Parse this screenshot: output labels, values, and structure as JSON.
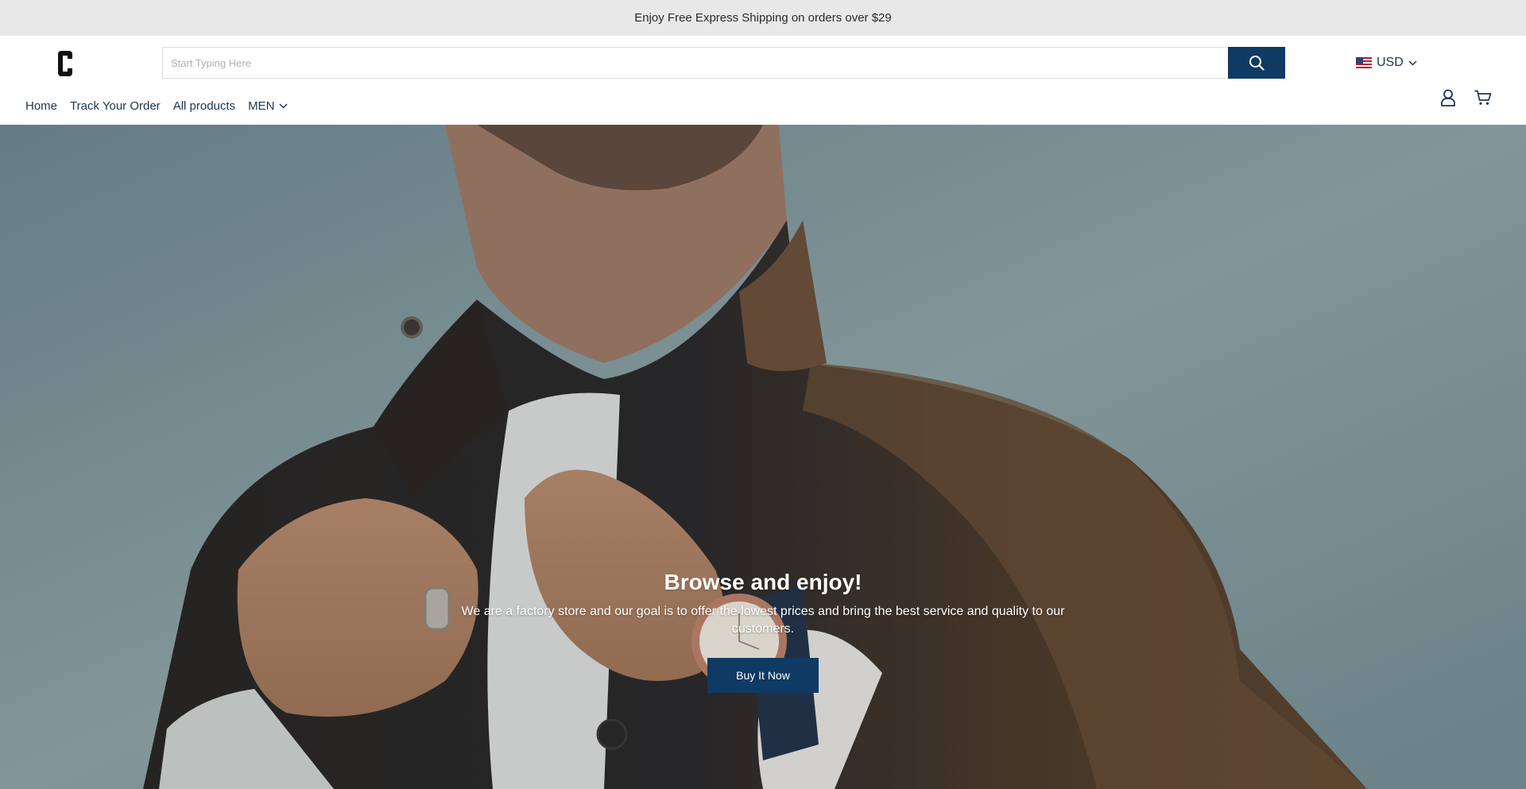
{
  "announcement": {
    "text": "Enjoy Free Express Shipping on orders over $29"
  },
  "header": {
    "logo_letter": "C",
    "search": {
      "placeholder": "Start Typing Here",
      "value": ""
    },
    "currency": {
      "code": "USD",
      "flag": "us-flag-icon"
    },
    "icons": {
      "search": "search-icon",
      "account": "user-icon",
      "cart": "cart-icon",
      "chevron": "chevron-down-icon"
    }
  },
  "nav": {
    "items": [
      {
        "label": "Home"
      },
      {
        "label": "Track Your Order"
      },
      {
        "label": "All products"
      },
      {
        "label": "MEN",
        "has_dropdown": true
      }
    ]
  },
  "hero": {
    "title": "Browse and enjoy!",
    "text": "We are a factory store and our goal is to offer the lowest prices and bring the best service and quality to our customers.",
    "button_label": "Buy It Now"
  },
  "colors": {
    "primary": "#0e3a63",
    "announcement_bg": "#e8e8e8",
    "nav_text": "#1c3550"
  }
}
